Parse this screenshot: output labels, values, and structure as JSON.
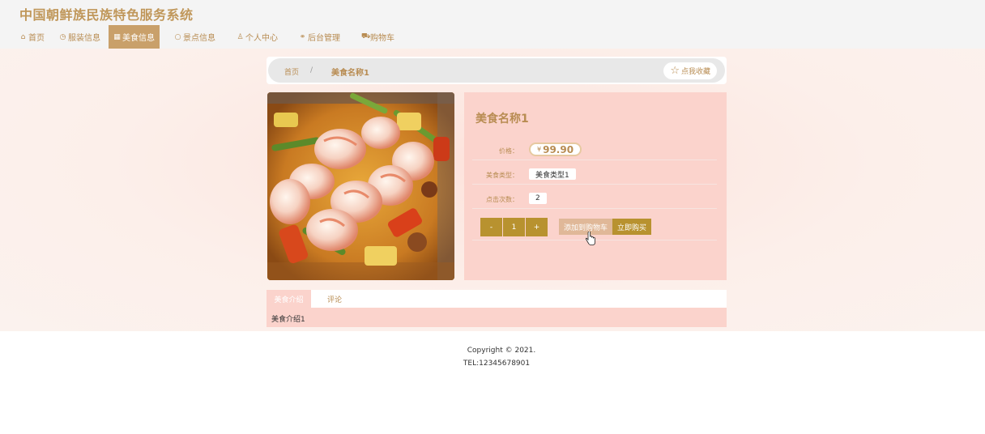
{
  "header": {
    "site_title": "中国朝鲜族民族特色服务系统"
  },
  "nav": {
    "items": [
      {
        "label": "首页",
        "icon": "home-icon"
      },
      {
        "label": "服装信息",
        "icon": "clock-icon"
      },
      {
        "label": "美食信息",
        "icon": "grid-icon"
      },
      {
        "label": "景点信息",
        "icon": "circle-icon"
      },
      {
        "label": "个人中心",
        "icon": "user-icon"
      },
      {
        "label": "后台管理",
        "icon": "link-icon"
      },
      {
        "label": "购物车",
        "icon": "cart-icon"
      }
    ],
    "active_index": 2
  },
  "breadcrumb": {
    "home": "首页",
    "separator": "/",
    "current": "美食名称1"
  },
  "favorite_button": {
    "label": "点我收藏",
    "icon": "star-icon"
  },
  "product": {
    "title": "美食名称1",
    "price_label": "价格：",
    "currency": "¥",
    "price": "99.90",
    "type_label": "美食类型：",
    "type_value": "美食类型1",
    "clicks_label": "点击次数：",
    "clicks_value": "2",
    "image": "shrimp-curry-dish"
  },
  "quantity": {
    "minus": "-",
    "value": "1",
    "plus": "+"
  },
  "actions": {
    "add_to_cart": "添加到购物车",
    "buy_now": "立即购买"
  },
  "tabs": {
    "items": [
      "美食介绍",
      "评论"
    ],
    "content": "美食介绍1"
  },
  "footer": {
    "copyright": "Copyright © 2021.",
    "tel": "TEL:12345678901"
  },
  "colors": {
    "accent": "#b88c52",
    "button": "#b8922f",
    "panel": "#fbd3cc"
  }
}
